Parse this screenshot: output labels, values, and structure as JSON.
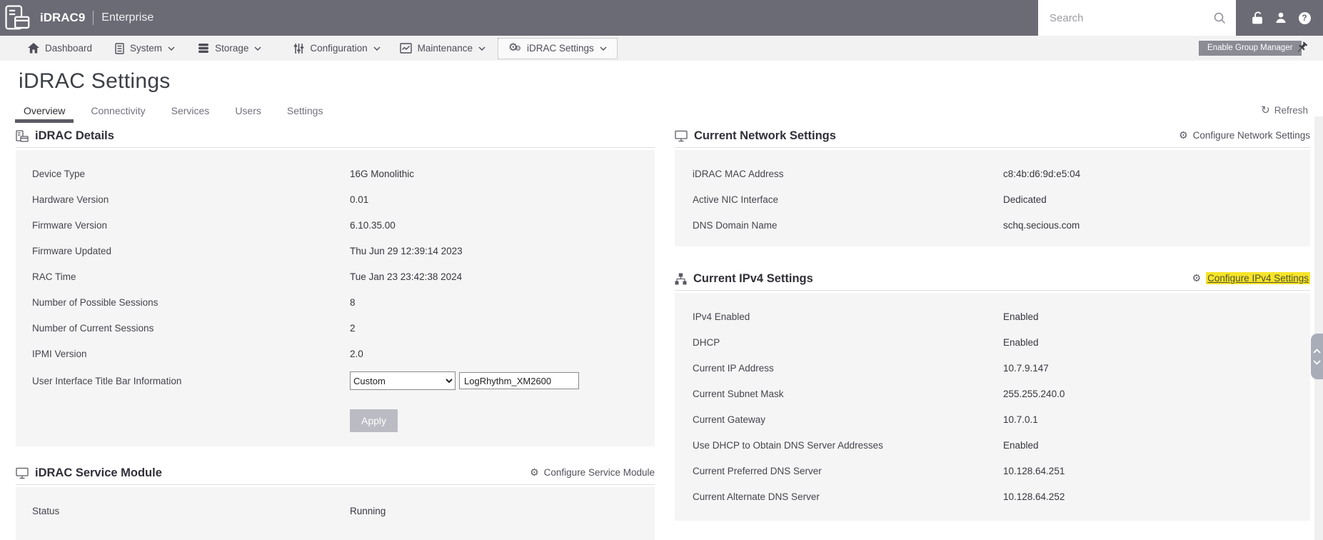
{
  "topbar": {
    "brand": "iDRAC9",
    "edition": "Enterprise",
    "search_placeholder": "Search"
  },
  "navbar": {
    "items": [
      {
        "label": "Dashboard"
      },
      {
        "label": "System"
      },
      {
        "label": "Storage"
      },
      {
        "label": "Configuration"
      },
      {
        "label": "Maintenance"
      },
      {
        "label": "iDRAC Settings"
      }
    ],
    "group_manager_label": "Enable Group Manager"
  },
  "page": {
    "title": "iDRAC Settings",
    "tabs": [
      "Overview",
      "Connectivity",
      "Services",
      "Users",
      "Settings"
    ],
    "active_tab": "Overview",
    "refresh_label": "Refresh"
  },
  "sections": {
    "idrac_details": {
      "title": "iDRAC Details",
      "rows": [
        {
          "label": "Device Type",
          "value": "16G Monolithic"
        },
        {
          "label": "Hardware Version",
          "value": "0.01"
        },
        {
          "label": "Firmware Version",
          "value": "6.10.35.00"
        },
        {
          "label": "Firmware Updated",
          "value": "Thu Jun 29 12:39:14 2023"
        },
        {
          "label": "RAC Time",
          "value": "Tue Jan 23 23:42:38 2024"
        },
        {
          "label": "Number of Possible Sessions",
          "value": "8"
        },
        {
          "label": "Number of Current Sessions",
          "value": "2"
        },
        {
          "label": "IPMI Version",
          "value": "2.0"
        }
      ],
      "titlebar": {
        "label": "User Interface Title Bar Information",
        "select_value": "Custom",
        "input_value": "LogRhythm_XM2600",
        "apply_label": "Apply"
      }
    },
    "service_module": {
      "title": "iDRAC Service Module",
      "link_label": "Configure Service Module",
      "rows": [
        {
          "label": "Status",
          "value": "Running"
        }
      ]
    },
    "network": {
      "title": "Current Network Settings",
      "link_label": "Configure Network Settings",
      "rows": [
        {
          "label": "iDRAC MAC Address",
          "value": "c8:4b:d6:9d:e5:04"
        },
        {
          "label": "Active NIC Interface",
          "value": "Dedicated"
        },
        {
          "label": "DNS Domain Name",
          "value": "schq.secious.com"
        }
      ]
    },
    "ipv4": {
      "title": "Current IPv4 Settings",
      "link_label": "Configure IPv4 Settings",
      "rows": [
        {
          "label": "IPv4 Enabled",
          "value": "Enabled"
        },
        {
          "label": "DHCP",
          "value": "Enabled"
        },
        {
          "label": "Current IP Address",
          "value": "10.7.9.147"
        },
        {
          "label": "Current Subnet Mask",
          "value": "255.255.240.0"
        },
        {
          "label": "Current Gateway",
          "value": "10.7.0.1"
        },
        {
          "label": "Use DHCP to Obtain DNS Server Addresses",
          "value": "Enabled"
        },
        {
          "label": "Current Preferred DNS Server",
          "value": "10.128.64.251"
        },
        {
          "label": "Current Alternate DNS Server",
          "value": "10.128.64.252"
        }
      ]
    }
  },
  "colors": {
    "topbar": "#6b6b75",
    "navbar": "#f2f2f3",
    "card": "#f5f5f6",
    "active_tab_underline": "#5b5b65",
    "highlight": "#f6e42a",
    "disabled_button": "#bbbbc3"
  }
}
